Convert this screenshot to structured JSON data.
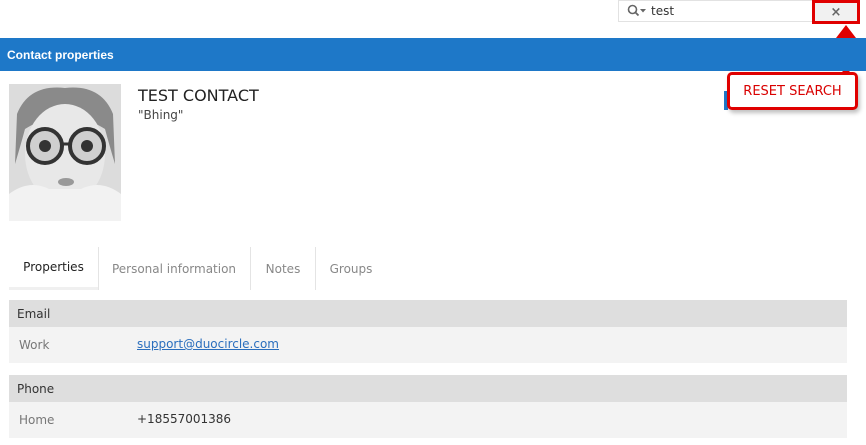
{
  "search": {
    "value": "test",
    "clear_label": "×"
  },
  "header": {
    "title": "Contact properties"
  },
  "contact": {
    "name": "TEST CONTACT",
    "nickname": "\"Bhing\""
  },
  "callout": {
    "label": "RESET SEARCH"
  },
  "tabs": [
    "Properties",
    "Personal information",
    "Notes",
    "Groups"
  ],
  "sections": {
    "email": {
      "title": "Email",
      "label": "Work",
      "value": "support@duocircle.com"
    },
    "phone": {
      "title": "Phone",
      "label": "Home",
      "value": "+18557001386"
    }
  },
  "colors": {
    "header_blue": "#1e78c8",
    "annotation_red": "#e00000"
  }
}
